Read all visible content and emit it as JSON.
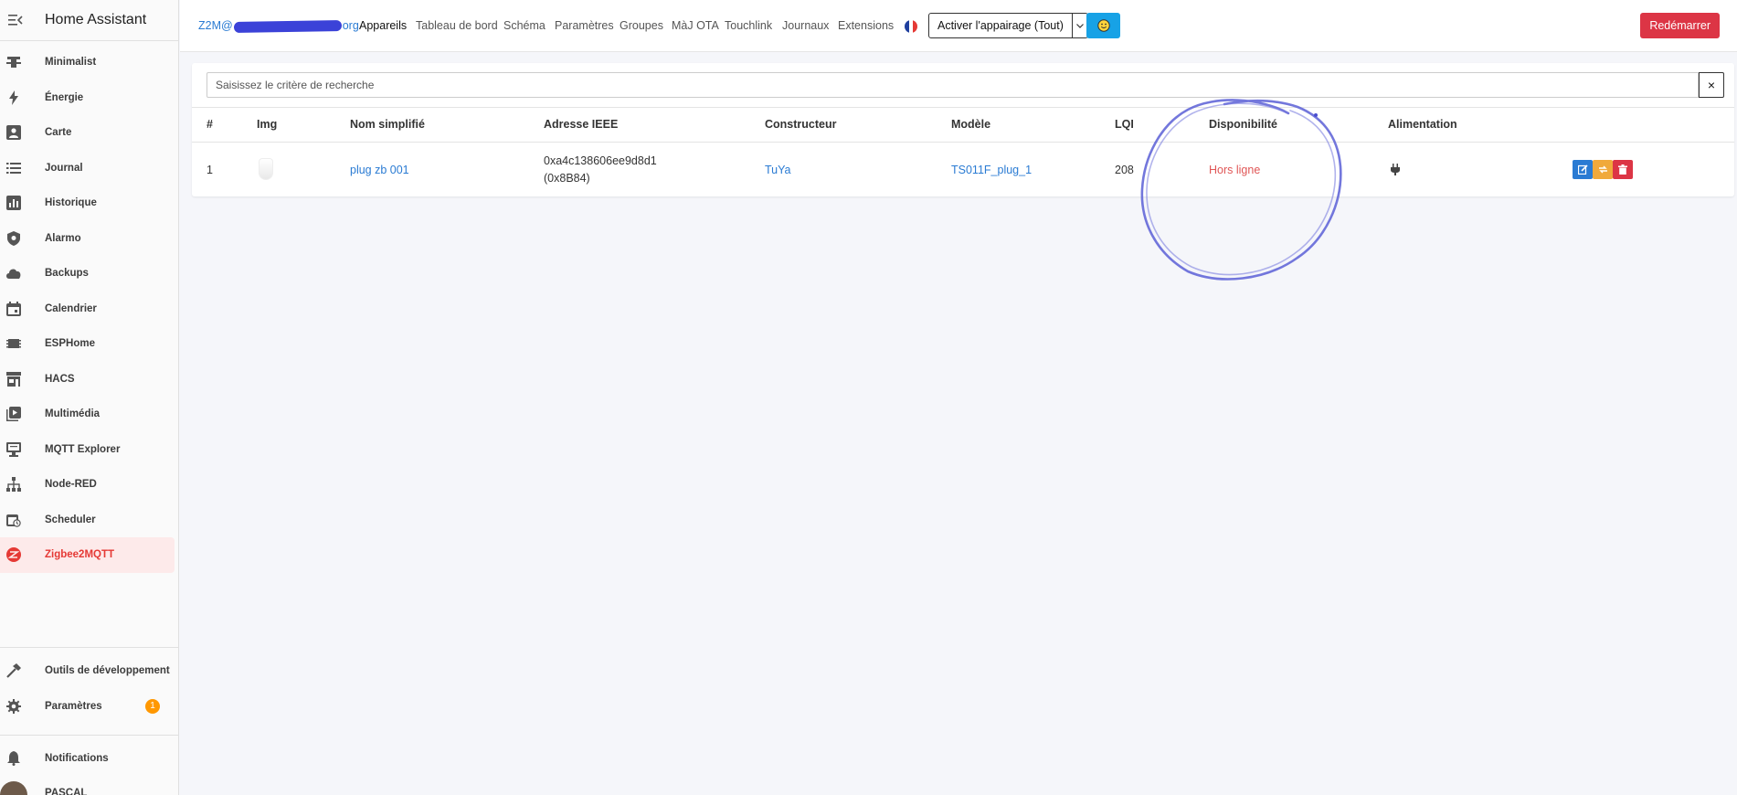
{
  "sidebar": {
    "title": "Home Assistant",
    "items": [
      {
        "label": "Minimalist",
        "icon": "tower-icon"
      },
      {
        "label": "Énergie",
        "icon": "lightning-icon"
      },
      {
        "label": "Carte",
        "icon": "account-box-icon"
      },
      {
        "label": "Journal",
        "icon": "list-icon"
      },
      {
        "label": "Historique",
        "icon": "chart-icon"
      },
      {
        "label": "Alarmo",
        "icon": "shield-icon"
      },
      {
        "label": "Backups",
        "icon": "cloud-icon"
      },
      {
        "label": "Calendrier",
        "icon": "calendar-icon"
      },
      {
        "label": "ESPHome",
        "icon": "chip-icon"
      },
      {
        "label": "HACS",
        "icon": "store-icon"
      },
      {
        "label": "Multimédia",
        "icon": "play-box-icon"
      },
      {
        "label": "MQTT Explorer",
        "icon": "monitor-icon"
      },
      {
        "label": "Node-RED",
        "icon": "sitemap-icon"
      },
      {
        "label": "Scheduler",
        "icon": "calendar-clock-icon"
      },
      {
        "label": "Zigbee2MQTT",
        "icon": "zigbee-icon"
      }
    ],
    "dev_tools": "Outils de développement",
    "settings": "Paramètres",
    "settings_badge": "1",
    "notifications": "Notifications",
    "user": "PASCAL"
  },
  "nav": {
    "brand_prefix": "Z2M@",
    "brand_suffix": "org",
    "links": [
      "Appareils",
      "Tableau de bord",
      "Schéma",
      "Paramètres",
      "Groupes",
      "MàJ OTA",
      "Touchlink",
      "Journaux",
      "Extensions"
    ],
    "pairing_button": "Activer l'appairage (Tout)",
    "restart_button": "Redémarrer"
  },
  "search": {
    "placeholder": "Saisissez le critère de recherche",
    "clear": "×"
  },
  "table": {
    "headers": [
      "#",
      "Img",
      "Nom simplifié",
      "Adresse IEEE",
      "Constructeur",
      "Modèle",
      "LQI",
      "Disponibilité",
      "Alimentation"
    ],
    "rows": [
      {
        "index": "1",
        "name": "plug zb 001",
        "ieee": "0xa4c138606ee9d8d1",
        "ieee_short": "(0x8B84)",
        "vendor": "TuYa",
        "model": "TS011F_plug_1",
        "lqi": "208",
        "availability": "Hors ligne",
        "power_icon": "plug-icon"
      }
    ]
  },
  "colors": {
    "brand_link": "#2a7bd3",
    "offline": "#e05656",
    "restart": "#dc3545",
    "active_sidebar_bg": "#fdeaea",
    "active_sidebar_text": "#e53935",
    "annotation": "#5b5fd6"
  }
}
